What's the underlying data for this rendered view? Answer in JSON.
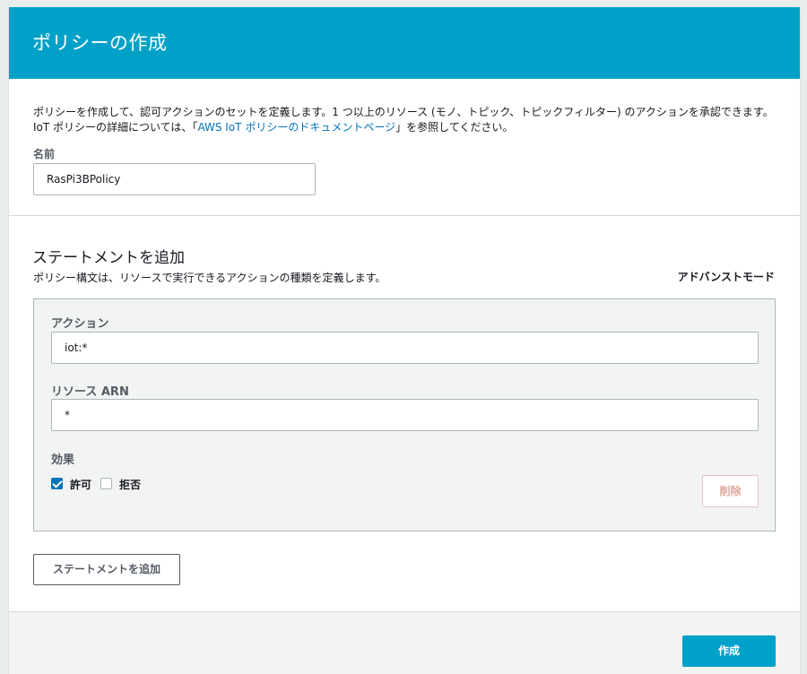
{
  "header": {
    "title": "ポリシーの作成"
  },
  "intro": {
    "text_before_link": "ポリシーを作成して、認可アクションのセットを定義します。1 つ以上のリソース (モノ、トピック、トピックフィルター) のアクションを承認できます。IoT ポリシーの詳細については、「",
    "link_text": "AWS IoT ポリシーのドキュメントページ",
    "text_after_link": "」を参照してください。"
  },
  "name_field": {
    "label": "名前",
    "value": "RasPi3BPolicy"
  },
  "statement_section": {
    "title": "ステートメントを追加",
    "subtitle": "ポリシー構文は、リソースで実行できるアクションの種類を定義します。",
    "advanced_mode": "アドバンストモード"
  },
  "statement": {
    "action_label": "アクション",
    "action_value": "iot:*",
    "resource_label": "リソース ARN",
    "resource_value": "*",
    "effect_label": "効果",
    "allow_label": "許可",
    "allow_checked": true,
    "deny_label": "拒否",
    "deny_checked": false,
    "delete_label": "削除"
  },
  "add_statement_button": "ステートメントを追加",
  "footer": {
    "create_label": "作成"
  },
  "colors": {
    "brand": "#00a1c9",
    "link": "#0073bb"
  }
}
